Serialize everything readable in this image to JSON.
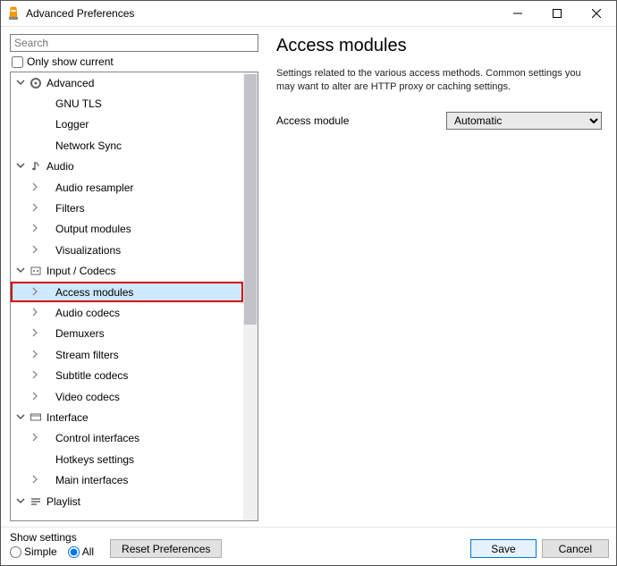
{
  "window": {
    "title": "Advanced Preferences"
  },
  "search": {
    "placeholder": "Search",
    "value": ""
  },
  "only_show_current_label": "Only show current",
  "tree": {
    "items": [
      {
        "label": "Advanced",
        "level": 0,
        "chevron": "down",
        "icon": "gear"
      },
      {
        "label": "GNU TLS",
        "level": 1,
        "chevron": "none",
        "icon": "none"
      },
      {
        "label": "Logger",
        "level": 1,
        "chevron": "none",
        "icon": "none"
      },
      {
        "label": "Network Sync",
        "level": 1,
        "chevron": "none",
        "icon": "none"
      },
      {
        "label": "Audio",
        "level": 0,
        "chevron": "down",
        "icon": "audio"
      },
      {
        "label": "Audio resampler",
        "level": 1,
        "chevron": "right",
        "icon": "none"
      },
      {
        "label": "Filters",
        "level": 1,
        "chevron": "right",
        "icon": "none"
      },
      {
        "label": "Output modules",
        "level": 1,
        "chevron": "right",
        "icon": "none"
      },
      {
        "label": "Visualizations",
        "level": 1,
        "chevron": "right",
        "icon": "none"
      },
      {
        "label": "Input / Codecs",
        "level": 0,
        "chevron": "down",
        "icon": "codec"
      },
      {
        "label": "Access modules",
        "level": 1,
        "chevron": "right",
        "icon": "none",
        "selected": true
      },
      {
        "label": "Audio codecs",
        "level": 1,
        "chevron": "right",
        "icon": "none"
      },
      {
        "label": "Demuxers",
        "level": 1,
        "chevron": "right",
        "icon": "none"
      },
      {
        "label": "Stream filters",
        "level": 1,
        "chevron": "right",
        "icon": "none"
      },
      {
        "label": "Subtitle codecs",
        "level": 1,
        "chevron": "right",
        "icon": "none"
      },
      {
        "label": "Video codecs",
        "level": 1,
        "chevron": "right",
        "icon": "none"
      },
      {
        "label": "Interface",
        "level": 0,
        "chevron": "down",
        "icon": "interface"
      },
      {
        "label": "Control interfaces",
        "level": 1,
        "chevron": "right",
        "icon": "none"
      },
      {
        "label": "Hotkeys settings",
        "level": 1,
        "chevron": "none",
        "icon": "none"
      },
      {
        "label": "Main interfaces",
        "level": 1,
        "chevron": "right",
        "icon": "none"
      },
      {
        "label": "Playlist",
        "level": 0,
        "chevron": "down",
        "icon": "playlist"
      }
    ]
  },
  "detail": {
    "heading": "Access modules",
    "description": "Settings related to the various access methods. Common settings you may want to alter are HTTP proxy or caching settings.",
    "field_label": "Access module",
    "field_value": "Automatic"
  },
  "footer": {
    "show_settings_label": "Show settings",
    "simple_label": "Simple",
    "all_label": "All",
    "reset_label": "Reset Preferences",
    "save_label": "Save",
    "cancel_label": "Cancel"
  }
}
